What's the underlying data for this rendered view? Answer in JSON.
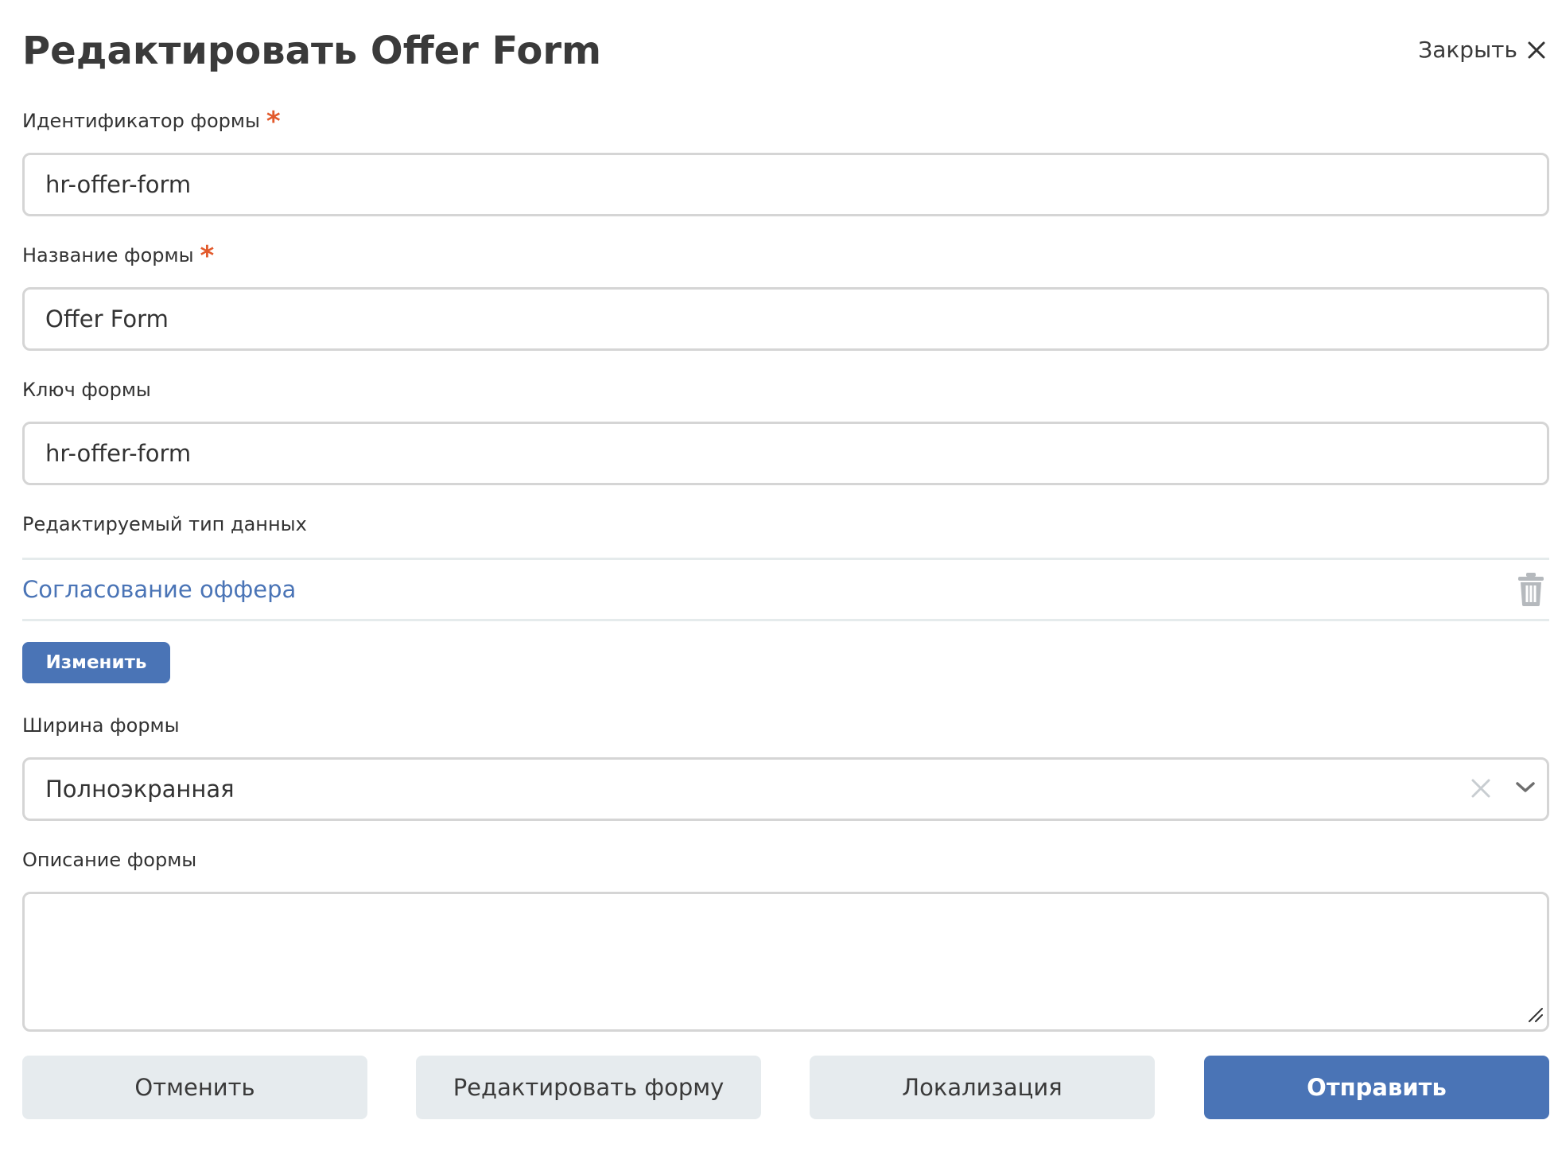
{
  "header": {
    "title": "Редактировать Offer Form",
    "close_label": "Закрыть"
  },
  "form": {
    "identifier": {
      "label": "Идентификатор формы",
      "required_mark": "*",
      "value": "hr-offer-form"
    },
    "name": {
      "label": "Название формы",
      "required_mark": "*",
      "value": "Offer Form"
    },
    "key": {
      "label": "Ключ формы",
      "value": "hr-offer-form"
    },
    "data_type": {
      "label": "Редактируемый тип данных",
      "value": "Согласование оффера",
      "change_label": "Изменить"
    },
    "width": {
      "label": "Ширина формы",
      "selected": "Полноэкранная"
    },
    "description": {
      "label": "Описание формы",
      "value": ""
    }
  },
  "footer": {
    "cancel_label": "Отменить",
    "edit_form_label": "Редактировать форму",
    "localization_label": "Локализация",
    "submit_label": "Отправить"
  },
  "colors": {
    "accent": "#4a74b6",
    "required": "#e25a2c",
    "secondary_button": "#e6ebee",
    "input_border": "#d5d5d5",
    "link": "#4a74b6"
  },
  "icons": {
    "close": "close-icon",
    "delete": "trash-icon",
    "clear": "clear-icon",
    "dropdown": "chevron-down-icon",
    "resize": "resize-grip-icon"
  }
}
